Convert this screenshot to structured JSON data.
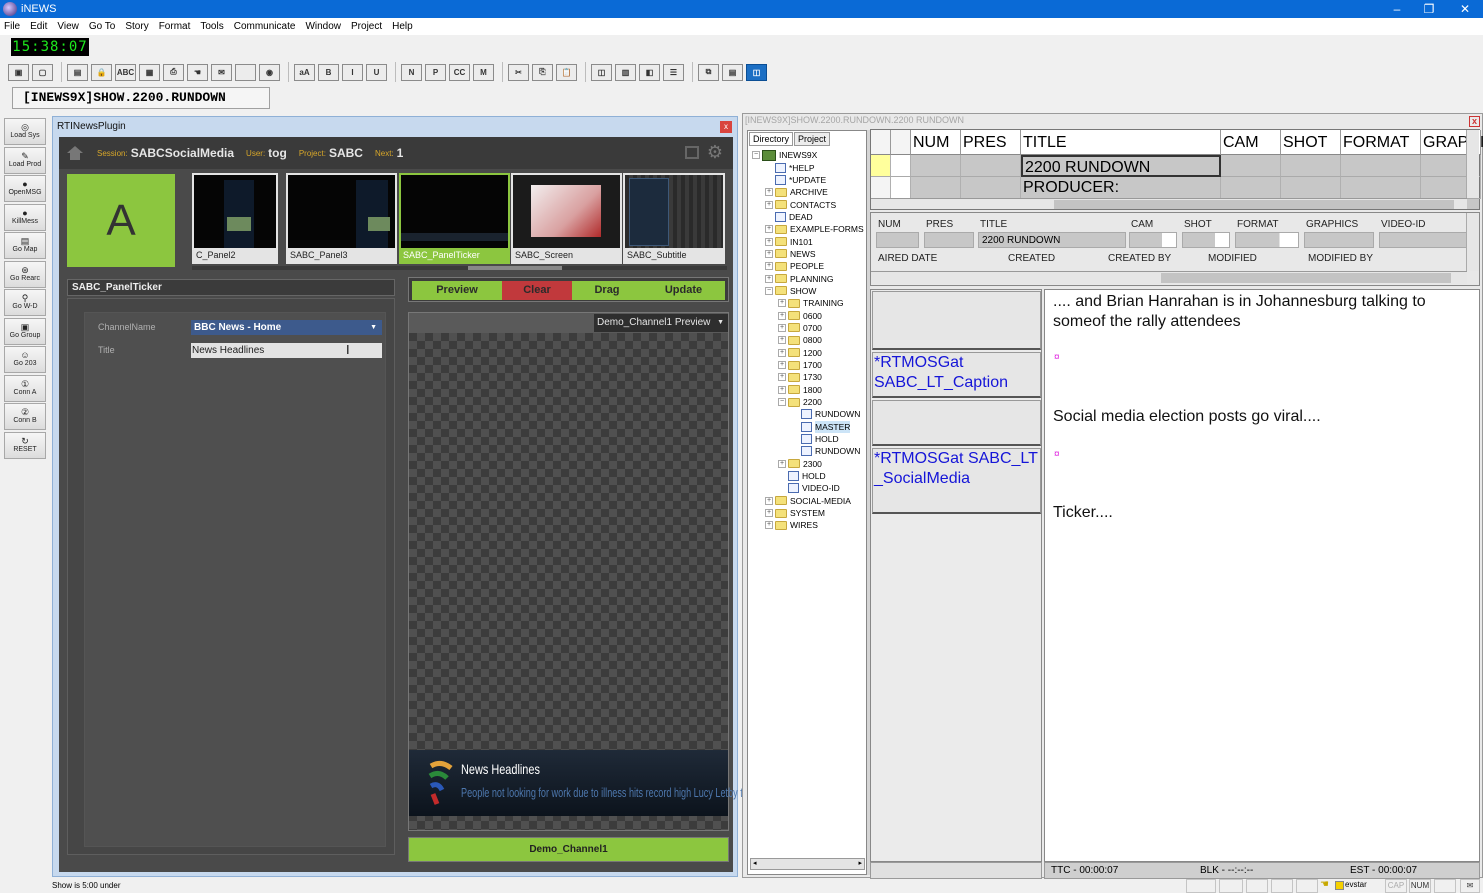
{
  "app": {
    "title": "iNEWS",
    "window_controls": {
      "minimize": "–",
      "restore": "❐",
      "close": "✕"
    }
  },
  "menu": [
    "File",
    "Edit",
    "View",
    "Go To",
    "Story",
    "Format",
    "Tools",
    "Communicate",
    "Window",
    "Project",
    "Help"
  ],
  "clock": "15:38:07",
  "toolbar": {
    "buttons": [
      {
        "name": "new-story-button",
        "glyph": "▣"
      },
      {
        "name": "open-button",
        "glyph": "▢"
      },
      {
        "sep": true
      },
      {
        "name": "copy-doc-button",
        "glyph": "▤"
      },
      {
        "name": "lock-button",
        "glyph": "🔒"
      },
      {
        "name": "spellcheck-button",
        "glyph": "ABC"
      },
      {
        "name": "save-button",
        "glyph": "▦"
      },
      {
        "name": "print-button",
        "glyph": "⎙"
      },
      {
        "name": "hand-button",
        "glyph": "☚"
      },
      {
        "name": "mail-button",
        "glyph": "✉"
      },
      {
        "name": "blank-button",
        "glyph": ""
      },
      {
        "name": "globe-button",
        "glyph": "◉"
      },
      {
        "sep": true
      },
      {
        "name": "font-size-button",
        "glyph": "aA"
      },
      {
        "name": "bold-button",
        "glyph": "B"
      },
      {
        "name": "italic-button",
        "glyph": "I"
      },
      {
        "name": "underline-button",
        "glyph": "U"
      },
      {
        "sep": true
      },
      {
        "name": "normal-button",
        "glyph": "N"
      },
      {
        "name": "presenter-button",
        "glyph": "P"
      },
      {
        "name": "cc-button",
        "glyph": "CC"
      },
      {
        "name": "machine-button",
        "glyph": "M"
      },
      {
        "sep": true
      },
      {
        "name": "cut-button",
        "glyph": "✂"
      },
      {
        "name": "copy-button",
        "glyph": "⎘"
      },
      {
        "name": "paste-button",
        "glyph": "📋"
      },
      {
        "sep": true
      },
      {
        "name": "layout-1-button",
        "glyph": "◫"
      },
      {
        "name": "layout-2-button",
        "glyph": "▥"
      },
      {
        "name": "layout-3-button",
        "glyph": "◧"
      },
      {
        "name": "layout-4-button",
        "glyph": "☰"
      },
      {
        "sep": true
      },
      {
        "name": "layout-5-button",
        "glyph": "⧉"
      },
      {
        "name": "layout-6-button",
        "glyph": "▤"
      },
      {
        "name": "layout-7-button",
        "glyph": "◫",
        "active": true
      }
    ]
  },
  "path": "[INEWS9X]SHOW.2200.RUNDOWN",
  "left_strip": [
    {
      "label": "Load Sys",
      "icon": "◎"
    },
    {
      "label": "Load Prod",
      "icon": "✎"
    },
    {
      "label": "OpenMSG",
      "icon": "●"
    },
    {
      "label": "KillMess",
      "icon": "●"
    },
    {
      "label": "Go Map",
      "icon": "▤"
    },
    {
      "label": "Go Rearc",
      "icon": "⊛"
    },
    {
      "label": "Go W-D",
      "icon": "⚲"
    },
    {
      "label": "Go Group",
      "icon": "▣"
    },
    {
      "label": "Go 203",
      "icon": "☺"
    },
    {
      "label": "Conn A",
      "icon": "①"
    },
    {
      "label": "Conn B",
      "icon": "②"
    },
    {
      "label": "RESET",
      "icon": "↻"
    }
  ],
  "plugin": {
    "title": "RTINewsPlugin",
    "close": "x",
    "session_label": "Session:",
    "session": "SABCSocialMedia",
    "user_label": "User:",
    "user": "tog",
    "project_label": "Project:",
    "project": "SABC",
    "next_label": "Next:",
    "next": "1",
    "layer": "A",
    "thumbnails": [
      {
        "label": "C_Panel2",
        "selected": false
      },
      {
        "label": "SABC_Panel3",
        "selected": false
      },
      {
        "label": "SABC_PanelTicker",
        "selected": true
      },
      {
        "label": "SABC_Screen",
        "selected": false
      },
      {
        "label": "SABC_Subtitle",
        "selected": false
      }
    ],
    "template_name": "SABC_PanelTicker",
    "fields": {
      "channel_label": "ChannelName",
      "channel_value": "BBC News - Home",
      "title_label": "Title",
      "title_value": "News Headlines"
    },
    "actions": {
      "preview": "Preview",
      "clear": "Clear",
      "drag": "Drag",
      "update": "Update"
    },
    "action_colors": {
      "green": "#8cc63f",
      "red": "#c1393c"
    },
    "preview_select": "Demo_Channel1 Preview",
    "ticker": {
      "headline": "News Headlines",
      "crawl": "People not looking for work due to illness hits record high      Lucy Letby tri"
    },
    "channel_button": "Demo_Channel1"
  },
  "rundown_window": {
    "title": "[INEWS9X]SHOW.2200.RUNDOWN.2200 RUNDOWN",
    "close": "x",
    "dir_tabs": [
      "Directory",
      "Project"
    ],
    "tree": [
      {
        "label": "INEWS9X",
        "level": 0,
        "type": "pc",
        "pm": "−"
      },
      {
        "label": "*HELP",
        "level": 1,
        "type": "doc"
      },
      {
        "label": "*UPDATE",
        "level": 1,
        "type": "doc"
      },
      {
        "label": "ARCHIVE",
        "level": 1,
        "type": "folder",
        "pm": "+"
      },
      {
        "label": "CONTACTS",
        "level": 1,
        "type": "folder",
        "pm": "+"
      },
      {
        "label": "DEAD",
        "level": 1,
        "type": "doc"
      },
      {
        "label": "EXAMPLE-FORMS",
        "level": 1,
        "type": "folder",
        "pm": "+"
      },
      {
        "label": "IN101",
        "level": 1,
        "type": "folder",
        "pm": "+"
      },
      {
        "label": "NEWS",
        "level": 1,
        "type": "folder",
        "pm": "+"
      },
      {
        "label": "PEOPLE",
        "level": 1,
        "type": "folder",
        "pm": "+"
      },
      {
        "label": "PLANNING",
        "level": 1,
        "type": "folder",
        "pm": "+"
      },
      {
        "label": "SHOW",
        "level": 1,
        "type": "folder",
        "pm": "−"
      },
      {
        "label": "TRAINING",
        "level": 2,
        "type": "folder",
        "pm": "+"
      },
      {
        "label": "0600",
        "level": 2,
        "type": "folder",
        "pm": "+"
      },
      {
        "label": "0700",
        "level": 2,
        "type": "folder",
        "pm": "+"
      },
      {
        "label": "0800",
        "level": 2,
        "type": "folder",
        "pm": "+"
      },
      {
        "label": "1200",
        "level": 2,
        "type": "folder",
        "pm": "+"
      },
      {
        "label": "1700",
        "level": 2,
        "type": "folder",
        "pm": "+"
      },
      {
        "label": "1730",
        "level": 2,
        "type": "folder",
        "pm": "+"
      },
      {
        "label": "1800",
        "level": 2,
        "type": "folder",
        "pm": "+"
      },
      {
        "label": "2200",
        "level": 2,
        "type": "folder",
        "pm": "−"
      },
      {
        "label": "RUNDOWN",
        "level": 3,
        "type": "doc"
      },
      {
        "label": "MASTER",
        "level": 3,
        "type": "doc",
        "selected": true
      },
      {
        "label": "HOLD",
        "level": 3,
        "type": "doc"
      },
      {
        "label": "RUNDOWN",
        "level": 3,
        "type": "doc"
      },
      {
        "label": "2300",
        "level": 2,
        "type": "folder",
        "pm": "+"
      },
      {
        "label": "HOLD",
        "level": 2,
        "type": "doc"
      },
      {
        "label": "VIDEO-ID",
        "level": 2,
        "type": "doc"
      },
      {
        "label": "SOCIAL-MEDIA",
        "level": 1,
        "type": "folder",
        "pm": "+"
      },
      {
        "label": "SYSTEM",
        "level": 1,
        "type": "folder",
        "pm": "+"
      },
      {
        "label": "WIRES",
        "level": 1,
        "type": "folder",
        "pm": "+"
      }
    ],
    "grid": {
      "columns": [
        "",
        "",
        "NUM",
        "PRES",
        "TITLE",
        "CAM",
        "SHOT",
        "FORMAT",
        "GRAPHICS"
      ],
      "rows": [
        {
          "title": "2200 RUNDOWN",
          "marker_color": "#ffff9c"
        },
        {
          "title": "PRODUCER:",
          "marker_color": "#f4f4f4"
        }
      ]
    },
    "form": {
      "row1_labels": [
        "NUM",
        "PRES",
        "TITLE",
        "CAM",
        "SHOT",
        "FORMAT",
        "GRAPHICS",
        "VIDEO-ID"
      ],
      "title_value": "2200 RUNDOWN",
      "row2_labels": [
        "AIRED DATE",
        "CREATED",
        "CREATED BY",
        "MODIFIED",
        "MODIFIED BY"
      ]
    },
    "instructions": [
      {
        "text": ""
      },
      {
        "text": "*RTMOSGat SABC_LT_Caption"
      },
      {
        "text": ""
      },
      {
        "text": "*RTMOSGat SABC_LT_SocialMedia"
      }
    ],
    "story": [
      ".... and Brian Hanrahan is in Johannesburg talking to someof the rally attendees",
      "¤",
      "Social media election posts go viral....",
      "¤",
      "Ticker...."
    ],
    "status": {
      "ttc": "TTC - 00:00:07",
      "blk": "BLK - --:--:--",
      "est": "EST - 00:00:07"
    }
  },
  "status_bar": {
    "message": "Show is 5:00 under",
    "user": "evstar",
    "cap": "CAP",
    "num": "NUM"
  }
}
